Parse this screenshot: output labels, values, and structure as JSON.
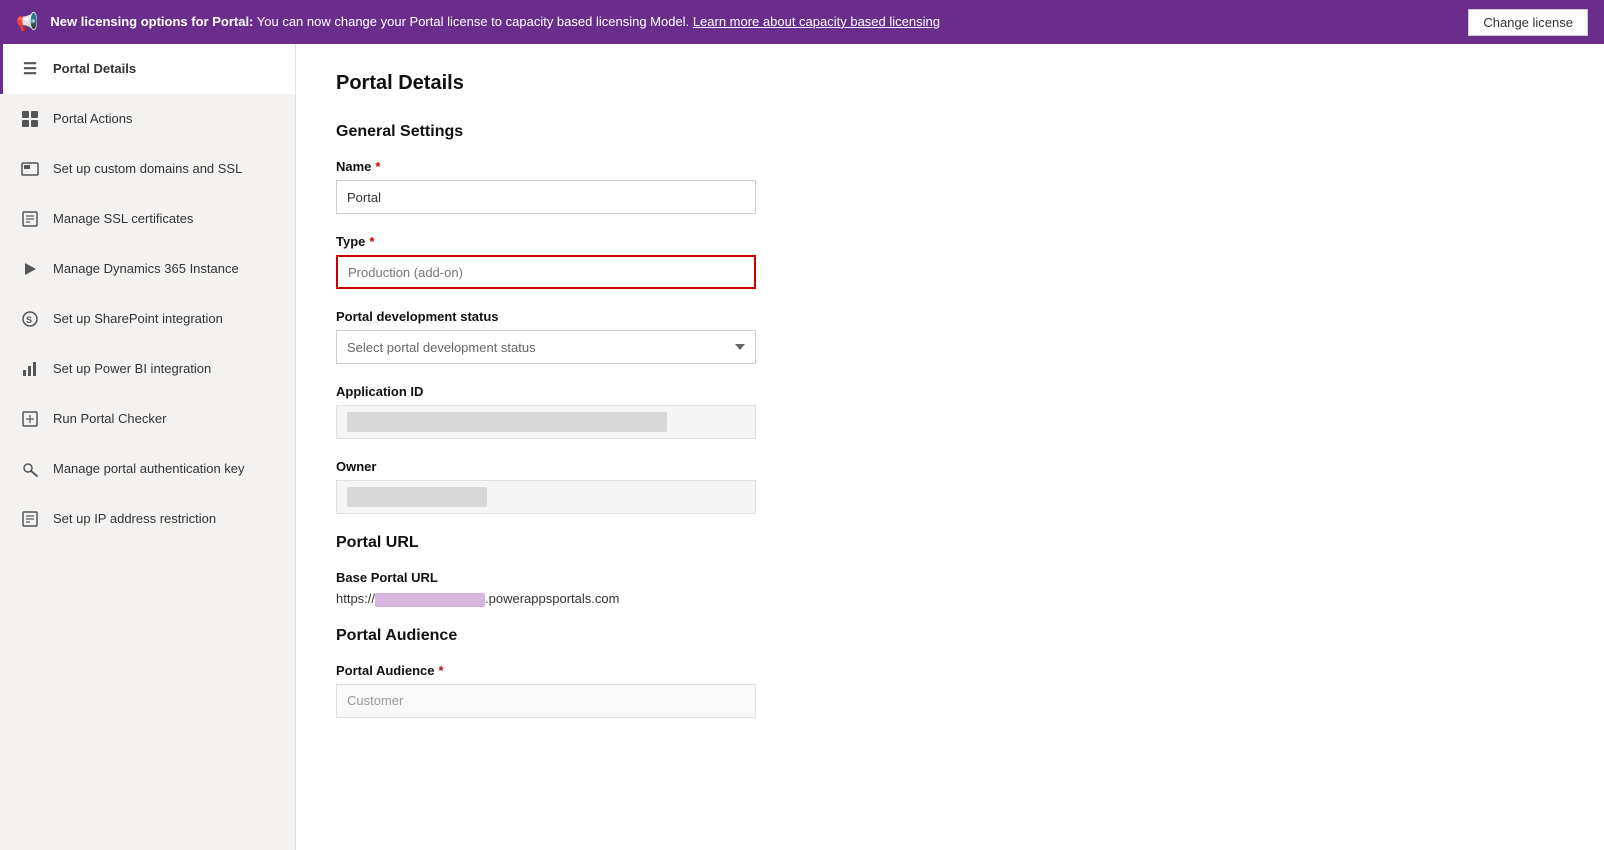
{
  "banner": {
    "icon": "📢",
    "text_bold": "New licensing options for Portal:",
    "text_normal": " You can now change your Portal license to capacity based licensing Model.",
    "link_text": "Learn more about capacity based licensing",
    "button_label": "Change license"
  },
  "sidebar": {
    "items": [
      {
        "id": "portal-details",
        "label": "Portal Details",
        "icon": "☰",
        "active": true
      },
      {
        "id": "portal-actions",
        "label": "Portal Actions",
        "icon": "⊞"
      },
      {
        "id": "custom-domains",
        "label": "Set up custom domains and SSL",
        "icon": "⊡"
      },
      {
        "id": "ssl-certs",
        "label": "Manage SSL certificates",
        "icon": "📄"
      },
      {
        "id": "dynamics-instance",
        "label": "Manage Dynamics 365 Instance",
        "icon": "▶"
      },
      {
        "id": "sharepoint",
        "label": "Set up SharePoint integration",
        "icon": "S"
      },
      {
        "id": "power-bi",
        "label": "Set up Power BI integration",
        "icon": "📊"
      },
      {
        "id": "portal-checker",
        "label": "Run Portal Checker",
        "icon": "⊠"
      },
      {
        "id": "auth-key",
        "label": "Manage portal authentication key",
        "icon": "🔒"
      },
      {
        "id": "ip-restriction",
        "label": "Set up IP address restriction",
        "icon": "📋"
      }
    ]
  },
  "content": {
    "page_title": "Portal Details",
    "general_settings_title": "General Settings",
    "name_label": "Name",
    "name_required": "*",
    "name_value": "Portal",
    "type_label": "Type",
    "type_required": "*",
    "type_placeholder": "Production (add-on)",
    "portal_dev_status_label": "Portal development status",
    "portal_dev_status_placeholder": "Select portal development status",
    "application_id_label": "Application ID",
    "owner_label": "Owner",
    "portal_url_title": "Portal URL",
    "base_portal_url_label": "Base Portal URL",
    "base_portal_url_prefix": "https://",
    "base_portal_url_suffix": ".powerappsportals.com",
    "portal_audience_title": "Portal Audience",
    "portal_audience_label": "Portal Audience",
    "portal_audience_required": "*",
    "portal_audience_value": "Customer"
  }
}
